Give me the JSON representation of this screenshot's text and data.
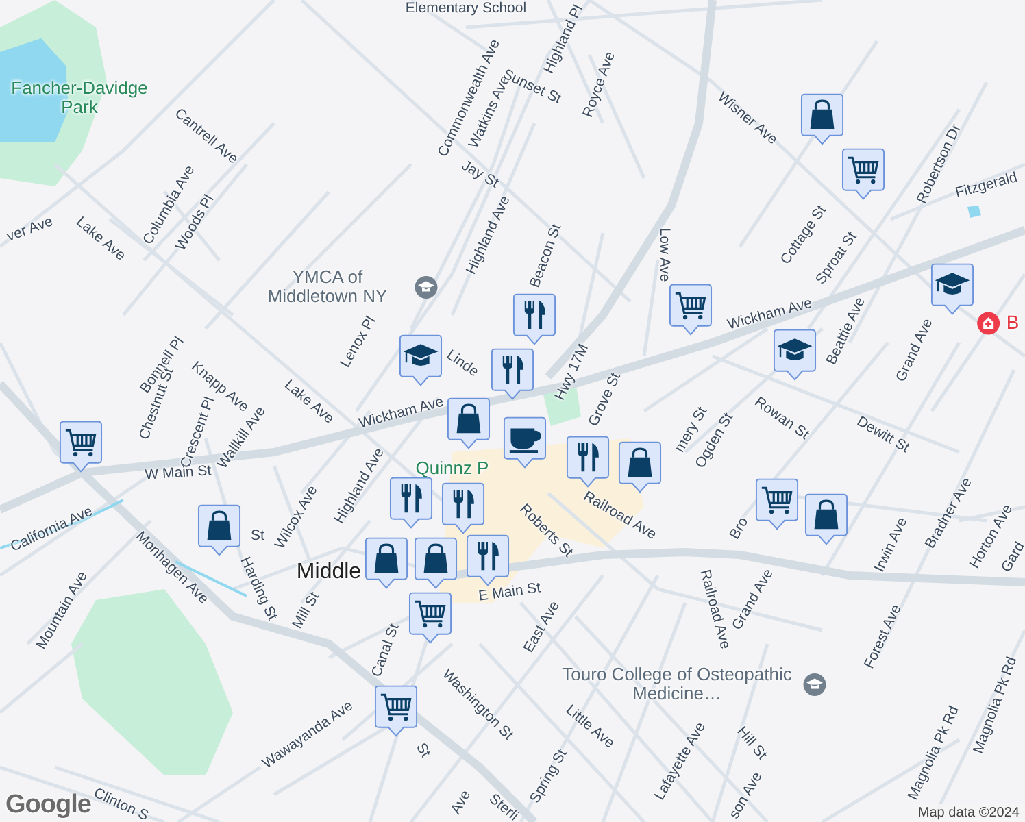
{
  "map": {
    "labels": [
      {
        "text": "Elementary School",
        "kind": "street"
      },
      {
        "text": "Fancher-Davidge Park",
        "kind": "park"
      },
      {
        "text": "Cantrell Ave",
        "kind": "street"
      },
      {
        "text": "Columbia Ave",
        "kind": "street"
      },
      {
        "text": "Woods Pl",
        "kind": "street"
      },
      {
        "text": "Lake Ave",
        "kind": "street"
      },
      {
        "text": "ver Ave",
        "kind": "street"
      },
      {
        "text": "Commonwealth Ave",
        "kind": "street"
      },
      {
        "text": "Watkins Ave",
        "kind": "street"
      },
      {
        "text": "Sunset St",
        "kind": "street"
      },
      {
        "text": "Highland Pl",
        "kind": "street"
      },
      {
        "text": "Jay St",
        "kind": "street"
      },
      {
        "text": "Highland Ave",
        "kind": "street"
      },
      {
        "text": "YMCA of Middletown NY",
        "kind": "school-poi"
      },
      {
        "text": "Royce Ave",
        "kind": "street"
      },
      {
        "text": "Wisner Ave",
        "kind": "street"
      },
      {
        "text": "Robertson Dr",
        "kind": "street"
      },
      {
        "text": "Fitzgerald",
        "kind": "street"
      },
      {
        "text": "Cottage St",
        "kind": "street"
      },
      {
        "text": "Sproat St",
        "kind": "street"
      },
      {
        "text": "Low Ave",
        "kind": "street"
      },
      {
        "text": "Wickham Ave",
        "kind": "street"
      },
      {
        "text": "Beattie Ave",
        "kind": "street"
      },
      {
        "text": "Grand Ave",
        "kind": "street"
      },
      {
        "text": "B",
        "kind": "hospital-poi"
      },
      {
        "text": "Beacon St",
        "kind": "street"
      },
      {
        "text": "Hwy 17M",
        "kind": "street"
      },
      {
        "text": "Lenox Pl",
        "kind": "street"
      },
      {
        "text": "Linde",
        "kind": "street"
      },
      {
        "text": "Bonnell Pl",
        "kind": "street"
      },
      {
        "text": "Chestnut St",
        "kind": "street"
      },
      {
        "text": "Knapp Ave",
        "kind": "street"
      },
      {
        "text": "Crescent Pl",
        "kind": "street"
      },
      {
        "text": "Wallkill Ave",
        "kind": "street"
      },
      {
        "text": "Lake Ave",
        "kind": "street"
      },
      {
        "text": "Wickham Ave",
        "kind": "street"
      },
      {
        "text": "W Main St",
        "kind": "street"
      },
      {
        "text": "Quinnz P",
        "kind": "park"
      },
      {
        "text": "Grove St",
        "kind": "street"
      },
      {
        "text": "mery St",
        "kind": "street"
      },
      {
        "text": "Ogden St",
        "kind": "street"
      },
      {
        "text": "Rowan St",
        "kind": "street"
      },
      {
        "text": "Dewitt St",
        "kind": "street"
      },
      {
        "text": "Railroad Ave",
        "kind": "street"
      },
      {
        "text": "Roberts St",
        "kind": "street"
      },
      {
        "text": "California Ave",
        "kind": "street"
      },
      {
        "text": "Monhagen Ave",
        "kind": "street"
      },
      {
        "text": "Wilcox Ave",
        "kind": "street"
      },
      {
        "text": "Highland Ave",
        "kind": "street"
      },
      {
        "text": "Harding St",
        "kind": "street"
      },
      {
        "text": "Mill St",
        "kind": "street"
      },
      {
        "text": "Middle",
        "kind": "town"
      },
      {
        "text": "E Main St",
        "kind": "street"
      },
      {
        "text": "Mountain Ave",
        "kind": "street"
      },
      {
        "text": "Canal St",
        "kind": "street"
      },
      {
        "text": "East Ave",
        "kind": "street"
      },
      {
        "text": "Bro",
        "kind": "street"
      },
      {
        "text": "Irwin Ave",
        "kind": "street"
      },
      {
        "text": "Bradner Ave",
        "kind": "street"
      },
      {
        "text": "Horton Ave",
        "kind": "street"
      },
      {
        "text": "Gard",
        "kind": "street"
      },
      {
        "text": "Railroad Ave",
        "kind": "street"
      },
      {
        "text": "Grand Ave",
        "kind": "street"
      },
      {
        "text": "Forest Ave",
        "kind": "street"
      },
      {
        "text": "Touro College of Osteopathic Medicine…",
        "kind": "school-poi"
      },
      {
        "text": "Washington St",
        "kind": "street"
      },
      {
        "text": "Little Ave",
        "kind": "street"
      },
      {
        "text": "Hill St",
        "kind": "street"
      },
      {
        "text": "Lafayette Ave",
        "kind": "street"
      },
      {
        "text": "Spring St",
        "kind": "street"
      },
      {
        "text": "son Ave",
        "kind": "street"
      },
      {
        "text": "Magnolia Pk Rd",
        "kind": "street"
      },
      {
        "text": "Magnolia Pk Rd",
        "kind": "street"
      },
      {
        "text": "Wawayanda Ave",
        "kind": "street"
      },
      {
        "text": "St",
        "kind": "street"
      },
      {
        "text": "Ave",
        "kind": "street"
      },
      {
        "text": "Sterli",
        "kind": "street"
      },
      {
        "text": "Clinton S",
        "kind": "street"
      },
      {
        "text": "St",
        "kind": "street"
      }
    ],
    "markers": [
      {
        "kind": "shopping"
      },
      {
        "kind": "grocery"
      },
      {
        "kind": "grocery"
      },
      {
        "kind": "school"
      },
      {
        "kind": "school"
      },
      {
        "kind": "school"
      },
      {
        "kind": "restaurant"
      },
      {
        "kind": "restaurant"
      },
      {
        "kind": "shopping"
      },
      {
        "kind": "cafe"
      },
      {
        "kind": "restaurant"
      },
      {
        "kind": "shopping"
      },
      {
        "kind": "grocery"
      },
      {
        "kind": "shopping"
      },
      {
        "kind": "grocery"
      },
      {
        "kind": "shopping"
      },
      {
        "kind": "restaurant"
      },
      {
        "kind": "restaurant"
      },
      {
        "kind": "shopping"
      },
      {
        "kind": "shopping"
      },
      {
        "kind": "restaurant"
      },
      {
        "kind": "grocery"
      },
      {
        "kind": "grocery"
      }
    ],
    "logo": "Google",
    "attribution": "Map data ©2024"
  }
}
